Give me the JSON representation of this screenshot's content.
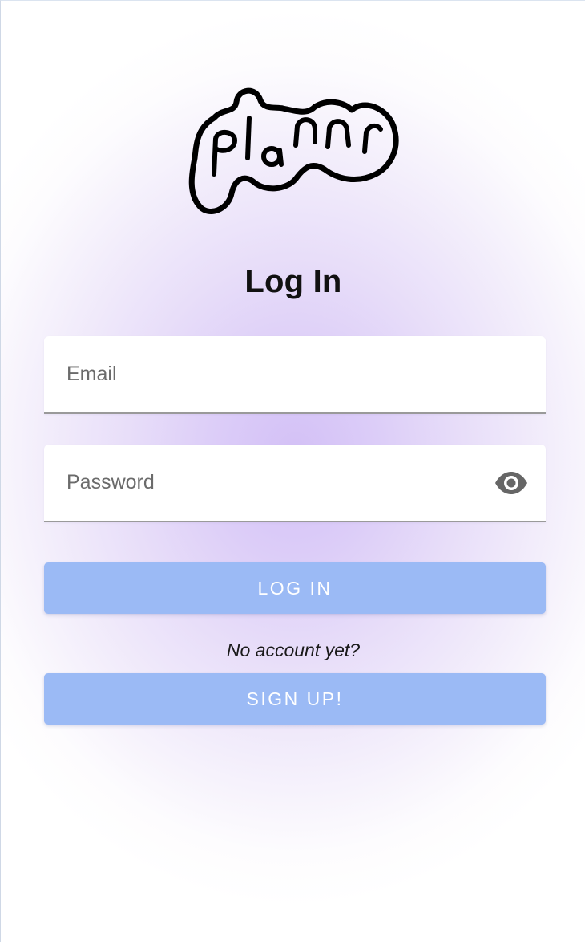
{
  "app": {
    "logo_text": "plannr"
  },
  "page": {
    "title": "Log In"
  },
  "form": {
    "email_placeholder": "Email",
    "password_placeholder": "Password",
    "password_toggle_icon": "eye-icon"
  },
  "actions": {
    "login_label": "LOG IN",
    "no_account_text": "No account yet?",
    "signup_label": "SIGN UP!"
  },
  "colors": {
    "button": "#9bbaf5",
    "button_text": "#ffffff",
    "background_glow": "#d3c0f6"
  }
}
